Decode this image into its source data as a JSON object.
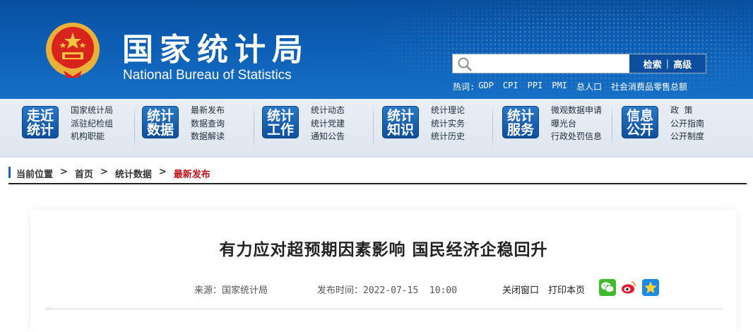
{
  "header": {
    "title_cn": "国家统计局",
    "title_en": "National Bureau of Statistics",
    "search": {
      "placeholder": "",
      "search_label": "检索",
      "separator": "|",
      "advanced_label": "高级"
    },
    "hot_label": "热词:",
    "hot_words": [
      "GDP",
      "CPI",
      "PPI",
      "PMI",
      "总人口",
      "社会消费品零售总额"
    ]
  },
  "nav": [
    {
      "badge": [
        "走近",
        "统计"
      ],
      "links": [
        "国家统计局",
        "派驻纪检组",
        "机构职能"
      ]
    },
    {
      "badge": [
        "统计",
        "数据"
      ],
      "links": [
        "最新发布",
        "数据查询",
        "数据解读"
      ]
    },
    {
      "badge": [
        "统计",
        "工作"
      ],
      "links": [
        "统计动态",
        "统计党建",
        "通知公告"
      ]
    },
    {
      "badge": [
        "统计",
        "知识"
      ],
      "links": [
        "统计理论",
        "统计实务",
        "统计历史"
      ]
    },
    {
      "badge": [
        "统计",
        "服务"
      ],
      "links": [
        "微观数据申请",
        "曝光台",
        "行政处罚信息"
      ]
    },
    {
      "badge": [
        "信息",
        "公开"
      ],
      "links": [
        "政  策",
        "公开指南",
        "公开制度"
      ]
    }
  ],
  "breadcrumb": {
    "label": "当前位置",
    "arrow": ">",
    "items": [
      "首页",
      "统计数据"
    ],
    "current": "最新发布"
  },
  "article": {
    "title": "有力应对超预期因素影响 国民经济企稳回升",
    "source": "来源：国家统计局",
    "published": "发布时间：2022-07-15  10:00",
    "close_label": "关闭窗口",
    "print_label": "打印本页",
    "share_icons": [
      "wechat-icon",
      "weibo-icon",
      "favorite-icon"
    ],
    "share_colors": {
      "wechat": "#3dbb2c",
      "weibo": "#e6162d",
      "favorite": "#1a8ae8"
    }
  }
}
